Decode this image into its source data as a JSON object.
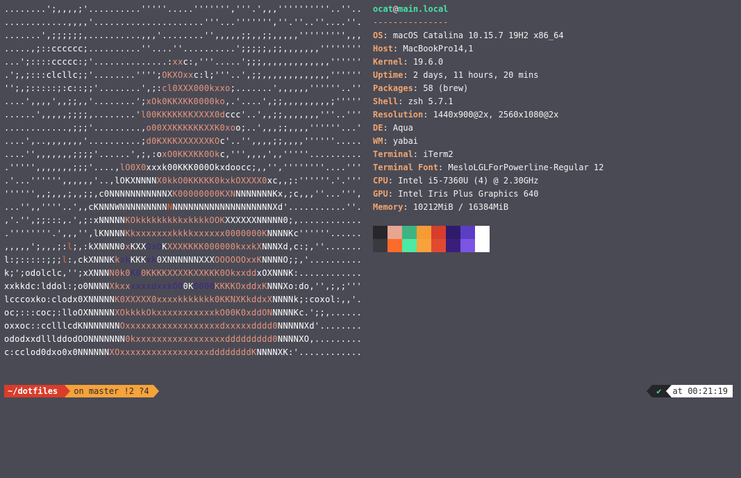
{
  "ascii_art_lines": [
    [
      [
        "w",
        "........';,,,,;'..........'''''.....''''''','''.',,,''''''''''..''...."
      ]
    ],
    [
      [
        "w",
        "............,,,,'.....................'''...''''''',''.''..''....''.."
      ]
    ],
    [
      [
        "w",
        ".......',;;;;;;,..........,,,'........'',,,,,;;,,;;,,,,,''''''''',,,''"
      ]
    ],
    [
      [
        "w",
        ".....,;::cccccc;..........''....''..........';;;;;,;;,,,,,,,''''''''''''"
      ]
    ],
    [
      [
        "w",
        "...';::::ccccc:;'..............:"
      ],
      [
        "p",
        "xx"
      ],
      [
        "w",
        "c:,'''.....';;;,,,,,,,,,,,,,''''''''"
      ]
    ],
    [
      [
        "w",
        ".';,;:::clcllc;;'........'''';"
      ],
      [
        "p",
        "OKXOxx"
      ],
      [
        "w",
        "c:l;'''..',;;,,,,,,,,,,,,,''''''''"
      ]
    ],
    [
      [
        "w",
        "'';,;:::::;:c::;;'........',;:"
      ],
      [
        "p",
        "cl0XXX000kxxo"
      ],
      [
        "w",
        ";.......',,,,,,''''''..''......"
      ]
    ],
    [
      [
        "w",
        "....',,,,',,;;,,'........';"
      ],
      [
        "p",
        "xOk0KKXKK0000ko"
      ],
      [
        "w",
        ",.'....',;;,,,,,,,,,;'''''''''"
      ]
    ],
    [
      [
        "w",
        "......',,,,,;;;;,........'"
      ],
      [
        "p",
        "l00KKKKKKKXXXX0d"
      ],
      [
        "w",
        "ccc'..',,;;,,,,,,,'''..''''''''"
      ]
    ],
    [
      [
        "w",
        "............,;;;'.........,"
      ],
      [
        "p",
        "o00XXKKKKKKXXK0xo"
      ],
      [
        "w",
        "o;..',,,;;,,,,''''''...''''''"
      ]
    ],
    [
      [
        "w",
        "....',..,,,,,,,'..........;"
      ],
      [
        "p",
        "d0KXKKXXXXXXKO"
      ],
      [
        "w",
        "c'..'',,,,;;,,,,''''''.........."
      ]
    ],
    [
      [
        "w",
        "....'',,,,,,,;;;;'......',;,:o"
      ],
      [
        "p",
        "xO0KKXKK0Ok"
      ],
      [
        "w",
        "c,''',,,,',,'''''.............."
      ]
    ],
    [
      [
        "w",
        ".''''',,,,,,,;;;'....,"
      ],
      [
        "p",
        "lO0X0"
      ],
      [
        "w",
        "xxxk00KKK000Okxdooc"
      ],
      [
        "w",
        "c;,,'',''''''''....''''''''"
      ]
    ],
    [
      [
        "w",
        ".'...'''''',,,,,,'..,lOKXNNNN"
      ],
      [
        "p",
        "X0kkO0KKKKK0kxkOXXXX0"
      ],
      [
        "w",
        "xc,,;:''''''.'.''''',''"
      ]
    ],
    [
      [
        "w",
        "'''''',,;,,,;,,;;,c0NNNNNNNNNNNX"
      ],
      [
        "p",
        "K00000000KXN"
      ],
      [
        "w",
        "NNNNNNNKx,;c,,,''...''',,,,"
      ]
    ],
    [
      [
        "w",
        "...'',,''''..',,cKNNNWNNNNNNNNN"
      ],
      [
        "o",
        "N"
      ],
      [
        "w",
        "NNNNNNNNNNNNNNNNNNNXd'...........''.."
      ]
    ],
    [
      [
        "w",
        ",'.'',;;:::,.',;:xNNNNN"
      ],
      [
        "p",
        "KOkkkkkkkkkxkkkkOOK"
      ],
      [
        "w",
        "XXXXXXNNNNN0;,..............."
      ]
    ],
    [
      [
        "w",
        ".''''''''.',,,'',lKNNNN"
      ],
      [
        "p",
        "Kkxxxxxxxkkkkxxxxxx0000000K"
      ],
      [
        "w",
        "NNNNKc''''''........;,,......"
      ]
    ],
    [
      [
        "w",
        ",,,,,';,,,;:"
      ],
      [
        "o",
        "l"
      ],
      [
        "w",
        ";,:kXNNNN0"
      ],
      [
        "p",
        "x"
      ],
      [
        "w",
        "KXX"
      ],
      [
        "d",
        "OxO"
      ],
      [
        "w",
        "K"
      ],
      [
        "p",
        "XXXKKKK000000kxxkX"
      ],
      [
        "w",
        "NNNXd,c:;,''.......,'.."
      ]
    ],
    [
      [
        "w",
        "l:;:::::;;;"
      ],
      [
        "o",
        "l"
      ],
      [
        "w",
        ":,ckXNNNK"
      ],
      [
        "p",
        "k"
      ],
      [
        "d",
        "xk"
      ],
      [
        "w",
        "KKK"
      ],
      [
        "d",
        "xk"
      ],
      [
        "w",
        "0XNNNNNNXXX"
      ],
      [
        "p",
        "OOOOOOxxK"
      ],
      [
        "w",
        "NNNNO;;,'..............."
      ]
    ],
    [
      [
        "w",
        "k;';odolclc,'';xXNNN"
      ],
      [
        "p",
        "N0k0"
      ],
      [
        "d",
        "K0"
      ],
      [
        "p",
        "0KKKKXXXXKXX"
      ],
      [
        "p",
        "KKK0Okxxdd"
      ],
      [
        "w",
        "xOXNNNK:..............."
      ]
    ],
    [
      [
        "w",
        "xxkkdc:lddol:;o0NNNN"
      ],
      [
        "p",
        "Xkxx"
      ],
      [
        "d",
        "xxxxdxxkO0"
      ],
      [
        "w",
        "0K"
      ],
      [
        "d",
        "0000"
      ],
      [
        "p",
        "KKKKOxddxK"
      ],
      [
        "w",
        "NNNXo:do,'',;,;'''....."
      ]
    ],
    [
      [
        "w",
        "lcccoxko:clodx0XNNNNN"
      ],
      [
        "p",
        "K0XXXXX0xxxxkkkkkkk0KKNXKkddxX"
      ],
      [
        "w",
        "NNNNk;:coxol:,,'......"
      ]
    ],
    [
      [
        "w",
        "oc;:::coc;:lloOXNNNNN"
      ],
      [
        "p",
        "XOkkkkOkxxxxxxxxxxxkO00K0xddON"
      ],
      [
        "w",
        "NNNNKc.';;,............."
      ]
    ],
    [
      [
        "w",
        "oxxoc::cclllcdKNNNNNNN"
      ],
      [
        "p",
        "Oxxxxxxxxxxxxxxxxxxdxxxxxdddd0"
      ],
      [
        "w",
        "NNNNNXd'..............."
      ]
    ],
    [
      [
        "w",
        "ododxxdlllddodOONNNNNNN"
      ],
      [
        "p",
        "0kxxxxxxxxxxxxxxxxxddddddddd0"
      ],
      [
        "w",
        "NNNNXO,................"
      ]
    ],
    [
      [
        "w",
        "c:cclod0dxo0x0NNNNNN"
      ],
      [
        "p",
        "XOxxxxxxxxxxxxxxxxxddddddddK"
      ],
      [
        "w",
        "NNNNXK:'..............."
      ]
    ]
  ],
  "sysinfo": {
    "user": "ocat",
    "at": "@",
    "hostname": "main.local",
    "separator": "---------------",
    "fields": [
      {
        "key": "OS",
        "value": "macOS Catalina 10.15.7 19H2 x86_64"
      },
      {
        "key": "Host",
        "value": "MacBookPro14,1"
      },
      {
        "key": "Kernel",
        "value": "19.6.0"
      },
      {
        "key": "Uptime",
        "value": "2 days, 11 hours, 20 mins"
      },
      {
        "key": "Packages",
        "value": "58 (brew)"
      },
      {
        "key": "Shell",
        "value": "zsh 5.7.1"
      },
      {
        "key": "Resolution",
        "value": "1440x900@2x, 2560x1080@2x"
      },
      {
        "key": "DE",
        "value": "Aqua"
      },
      {
        "key": "WM",
        "value": "yabai"
      },
      {
        "key": "Terminal",
        "value": "iTerm2"
      },
      {
        "key": "Terminal Font",
        "value": "MesloLGLForPowerline-Regular 12"
      },
      {
        "key": "CPU",
        "value": "Intel i5-7360U (4) @ 2.30GHz"
      },
      {
        "key": "GPU",
        "value": "Intel Iris Plus Graphics 640"
      },
      {
        "key": "Memory",
        "value": "10212MiB / 16384MiB"
      }
    ]
  },
  "palette": {
    "top": [
      "#27262b",
      "#e7a592",
      "#3fb382",
      "#f59c35",
      "#d73d2d",
      "#2f1b6b",
      "#5c3ec4",
      "#ffffff"
    ],
    "bottom": [
      "#3a3a3e",
      "#fd6b2b",
      "#4ee9a3",
      "#f9a13a",
      "#e14a31",
      "#3b1e79",
      "#7b55e3",
      "#ffffff"
    ]
  },
  "prompt": {
    "path": "~/dotfiles",
    "git": "on master !2 ?4",
    "status_icon": "✔",
    "time": "at 00:21:19"
  },
  "colors": {
    "background": "#4a4a55",
    "accent_green": "#48e3a2",
    "accent_orange": "#f0a56f",
    "path_red": "#d93d2a",
    "git_yellow": "#f6a33a"
  }
}
